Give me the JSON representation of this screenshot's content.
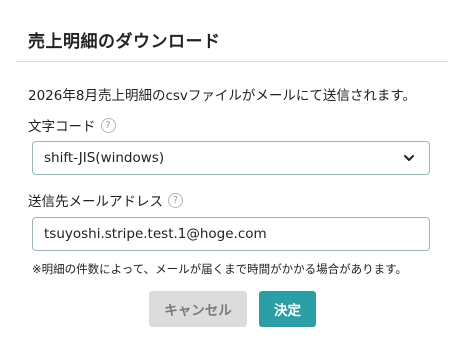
{
  "dialog": {
    "title": "売上明細のダウンロード",
    "message": "2026年8月売上明細のcsvファイルがメールにて送信されます。",
    "encoding": {
      "label": "文字コード",
      "help_glyph": "?",
      "selected_value": "shift-JIS(windows)",
      "icon": "chevron-down-icon"
    },
    "email": {
      "label": "送信先メールアドレス",
      "help_glyph": "?",
      "value": "tsuyoshi.stripe.test.1@hoge.com"
    },
    "note": "※明細の件数によって、メールが届くまで時間がかかる場合があります。",
    "buttons": {
      "cancel_label": "キャンセル",
      "confirm_label": "決定"
    }
  },
  "colors": {
    "accent": "#2c9ea6",
    "input_border": "#9ab8ba",
    "cancel_bg": "#dcdcdc"
  }
}
